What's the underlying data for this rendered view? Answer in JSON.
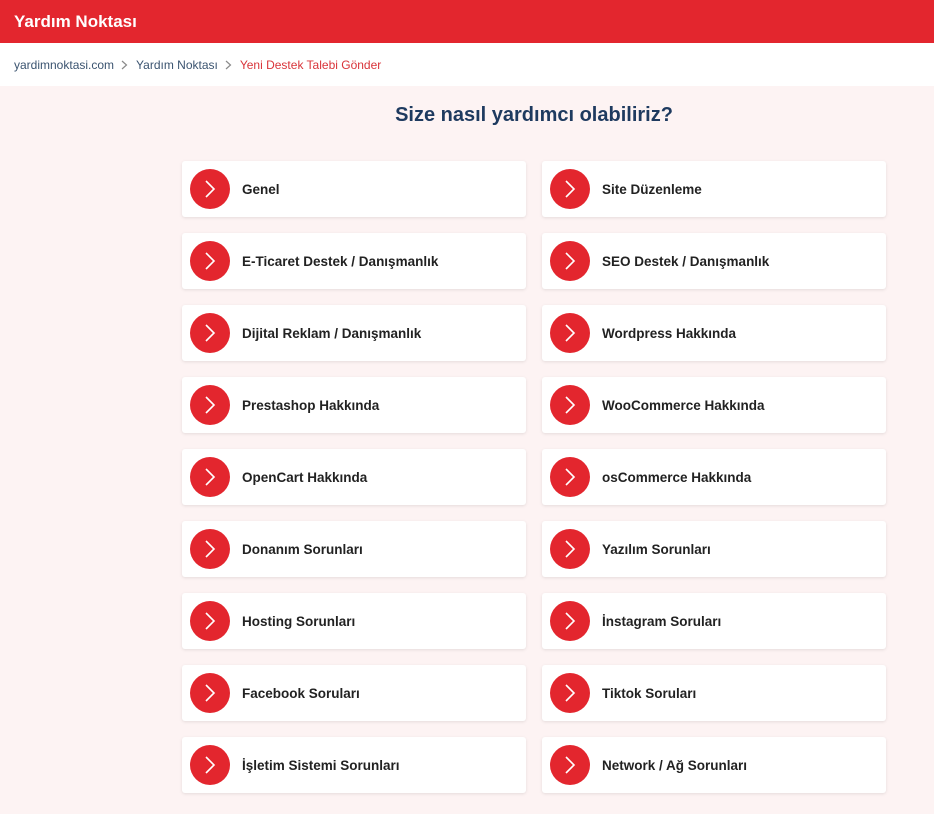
{
  "header": {
    "brand": "Yardım Noktası"
  },
  "breadcrumb": {
    "items": [
      {
        "label": "yardimnoktasi.com"
      },
      {
        "label": "Yardım Noktası"
      },
      {
        "label": "Yeni Destek Talebi Gönder"
      }
    ]
  },
  "main": {
    "heading": "Size nasıl yardımcı olabiliriz?",
    "categories": [
      {
        "label": "Genel"
      },
      {
        "label": "Site Düzenleme"
      },
      {
        "label": "E-Ticaret Destek / Danışmanlık"
      },
      {
        "label": "SEO Destek / Danışmanlık"
      },
      {
        "label": "Dijital Reklam / Danışmanlık"
      },
      {
        "label": "Wordpress Hakkında"
      },
      {
        "label": "Prestashop Hakkında"
      },
      {
        "label": "WooCommerce Hakkında"
      },
      {
        "label": "OpenCart Hakkında"
      },
      {
        "label": "osCommerce Hakkında"
      },
      {
        "label": "Donanım Sorunları"
      },
      {
        "label": "Yazılım Sorunları"
      },
      {
        "label": "Hosting Sorunları"
      },
      {
        "label": "İnstagram Soruları"
      },
      {
        "label": "Facebook Soruları"
      },
      {
        "label": "Tiktok Soruları"
      },
      {
        "label": "İşletim Sistemi Sorunları"
      },
      {
        "label": "Network / Ağ Sorunları"
      }
    ]
  },
  "icons": {
    "category": "chevron-right-icon",
    "breadcrumb_separator": "chevron-right-icon"
  },
  "colors": {
    "accent": "#e3262e",
    "heading": "#1e3a5f",
    "page_background": "#fdf3f3"
  }
}
